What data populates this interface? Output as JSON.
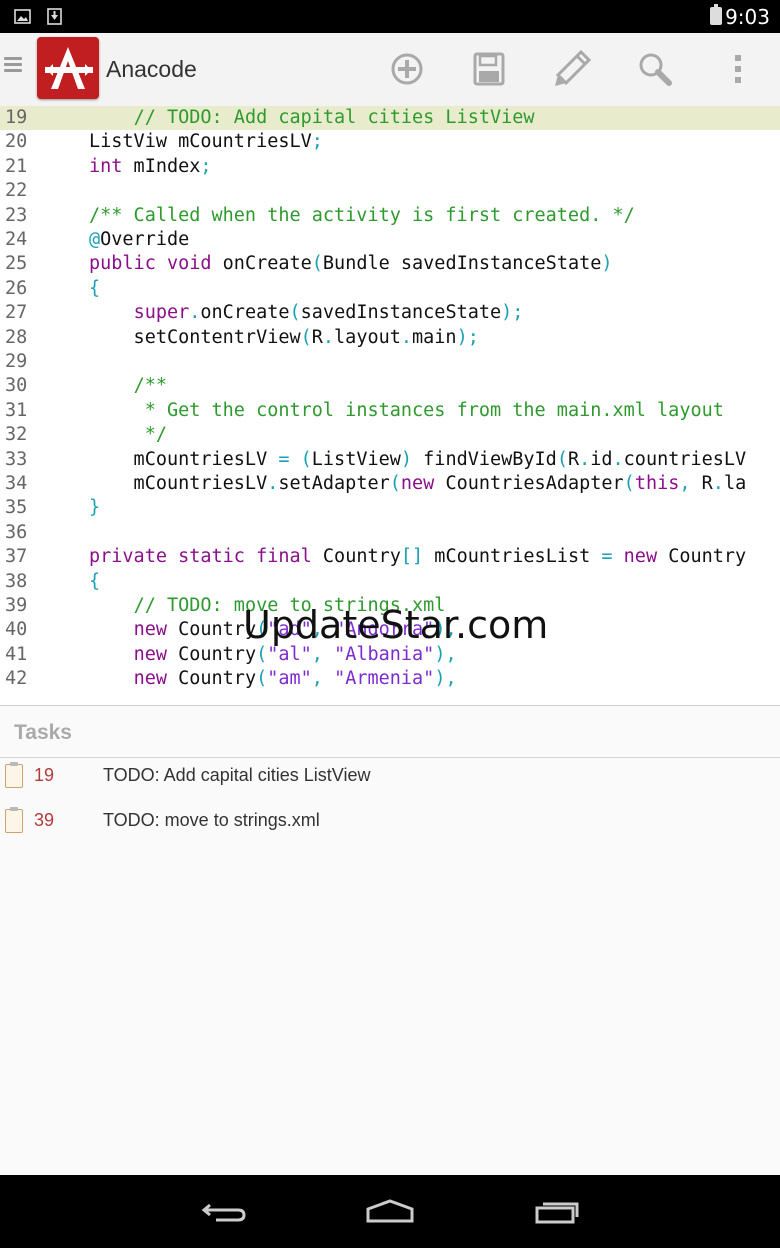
{
  "status_bar": {
    "time": "9:03"
  },
  "app": {
    "title": "Anacode"
  },
  "toolbar": {
    "icons": [
      "add-icon",
      "save-icon",
      "edit-icon",
      "search-icon",
      "overflow-menu-icon"
    ]
  },
  "editor": {
    "highlighted_line": 19,
    "lines": [
      {
        "num": "19",
        "tokens": [
          [
            "    ",
            ""
          ],
          [
            "// TODO: Add capital cities ListView",
            "cm"
          ]
        ]
      },
      {
        "num": "20",
        "tokens": [
          [
            "ListViw mCountriesLV",
            ""
          ],
          [
            ";",
            "pn"
          ]
        ]
      },
      {
        "num": "21",
        "tokens": [
          [
            "int",
            "kw"
          ],
          [
            " mIndex",
            ""
          ],
          [
            ";",
            "pn"
          ]
        ]
      },
      {
        "num": "22",
        "tokens": []
      },
      {
        "num": "23",
        "tokens": [
          [
            "/** Called when the activity is first created. */",
            "cm"
          ]
        ]
      },
      {
        "num": "24",
        "tokens": [
          [
            "@",
            "an"
          ],
          [
            "Override",
            ""
          ]
        ]
      },
      {
        "num": "25",
        "tokens": [
          [
            "public",
            "kw"
          ],
          [
            " ",
            ""
          ],
          [
            "void",
            "kw"
          ],
          [
            " onCreate",
            ""
          ],
          [
            "(",
            "pn"
          ],
          [
            "Bundle savedInstanceState",
            ""
          ],
          [
            ")",
            "pn"
          ]
        ]
      },
      {
        "num": "26",
        "tokens": [
          [
            "{",
            "pn"
          ]
        ]
      },
      {
        "num": "27",
        "tokens": [
          [
            "    ",
            ""
          ],
          [
            "super",
            "kw"
          ],
          [
            ".",
            "pn"
          ],
          [
            "onCreate",
            ""
          ],
          [
            "(",
            "pn"
          ],
          [
            "savedInstanceState",
            ""
          ],
          [
            ");",
            "pn"
          ]
        ]
      },
      {
        "num": "28",
        "tokens": [
          [
            "    setContentrView",
            ""
          ],
          [
            "(",
            "pn"
          ],
          [
            "R",
            ""
          ],
          [
            ".",
            "pn"
          ],
          [
            "layout",
            ""
          ],
          [
            ".",
            "pn"
          ],
          [
            "main",
            ""
          ],
          [
            ");",
            "pn"
          ]
        ]
      },
      {
        "num": "29",
        "tokens": []
      },
      {
        "num": "30",
        "tokens": [
          [
            "    ",
            ""
          ],
          [
            "/**",
            "cm"
          ]
        ]
      },
      {
        "num": "31",
        "tokens": [
          [
            "    ",
            ""
          ],
          [
            " * Get the control instances from the main.xml layout",
            "cm"
          ]
        ]
      },
      {
        "num": "32",
        "tokens": [
          [
            "    ",
            ""
          ],
          [
            " */",
            "cm"
          ]
        ]
      },
      {
        "num": "33",
        "tokens": [
          [
            "    mCountriesLV ",
            ""
          ],
          [
            "=",
            "pn"
          ],
          [
            " ",
            ""
          ],
          [
            "(",
            "pn"
          ],
          [
            "ListView",
            ""
          ],
          [
            ")",
            "pn"
          ],
          [
            " findViewById",
            ""
          ],
          [
            "(",
            "pn"
          ],
          [
            "R",
            ""
          ],
          [
            ".",
            "pn"
          ],
          [
            "id",
            ""
          ],
          [
            ".",
            "pn"
          ],
          [
            "countriesLV",
            ""
          ]
        ]
      },
      {
        "num": "34",
        "tokens": [
          [
            "    mCountriesLV",
            ""
          ],
          [
            ".",
            "pn"
          ],
          [
            "setAdapter",
            ""
          ],
          [
            "(",
            "pn"
          ],
          [
            "new",
            "kw"
          ],
          [
            " CountriesAdapter",
            ""
          ],
          [
            "(",
            "pn"
          ],
          [
            "this",
            "kw"
          ],
          [
            ",",
            "pn"
          ],
          [
            " R",
            ""
          ],
          [
            ".",
            "pn"
          ],
          [
            "la",
            ""
          ]
        ]
      },
      {
        "num": "35",
        "tokens": [
          [
            "}",
            "pn"
          ]
        ]
      },
      {
        "num": "36",
        "tokens": []
      },
      {
        "num": "37",
        "tokens": [
          [
            "private",
            "kw"
          ],
          [
            " ",
            ""
          ],
          [
            "static",
            "kw"
          ],
          [
            " ",
            ""
          ],
          [
            "final",
            "kw"
          ],
          [
            " Country",
            ""
          ],
          [
            "[]",
            "pn"
          ],
          [
            " mCountriesList ",
            ""
          ],
          [
            "=",
            "pn"
          ],
          [
            " ",
            ""
          ],
          [
            "new",
            "kw"
          ],
          [
            " Country",
            ""
          ]
        ]
      },
      {
        "num": "38",
        "tokens": [
          [
            "{",
            "pn"
          ]
        ]
      },
      {
        "num": "39",
        "tokens": [
          [
            "    ",
            ""
          ],
          [
            "// TODO: move to strings.xml",
            "cm"
          ]
        ]
      },
      {
        "num": "40",
        "tokens": [
          [
            "    ",
            ""
          ],
          [
            "new",
            "kw"
          ],
          [
            " Country",
            ""
          ],
          [
            "(",
            "pn"
          ],
          [
            "\"ad\"",
            "st"
          ],
          [
            ",",
            "pn"
          ],
          [
            " ",
            ""
          ],
          [
            "\"Andorra\"",
            "st"
          ],
          [
            "),",
            "pn"
          ]
        ]
      },
      {
        "num": "41",
        "tokens": [
          [
            "    ",
            ""
          ],
          [
            "new",
            "kw"
          ],
          [
            " Country",
            ""
          ],
          [
            "(",
            "pn"
          ],
          [
            "\"al\"",
            "st"
          ],
          [
            ",",
            "pn"
          ],
          [
            " ",
            ""
          ],
          [
            "\"Albania\"",
            "st"
          ],
          [
            "),",
            "pn"
          ]
        ]
      },
      {
        "num": "42",
        "tokens": [
          [
            "    ",
            ""
          ],
          [
            "new",
            "kw"
          ],
          [
            " Country",
            ""
          ],
          [
            "(",
            "pn"
          ],
          [
            "\"am\"",
            "st"
          ],
          [
            ",",
            "pn"
          ],
          [
            " ",
            ""
          ],
          [
            "\"Armenia\"",
            "st"
          ],
          [
            "),",
            "pn"
          ]
        ]
      }
    ]
  },
  "watermark": "UpdateStar.com",
  "tasks": {
    "title": "Tasks",
    "items": [
      {
        "line": "19",
        "text": "TODO: Add capital cities ListView"
      },
      {
        "line": "39",
        "text": "TODO: move to strings.xml"
      }
    ]
  },
  "navigation": {
    "buttons": [
      "back-icon",
      "home-icon",
      "recents-icon"
    ]
  },
  "colors": {
    "logo_red": "#c01e21",
    "highlight_line": "#e8eccd",
    "comment": "#2e9a2e",
    "keyword": "#8b0f8b",
    "punctuation": "#1aa0b5",
    "string": "#7d2bd1",
    "task_line_number": "#b53b3b"
  }
}
